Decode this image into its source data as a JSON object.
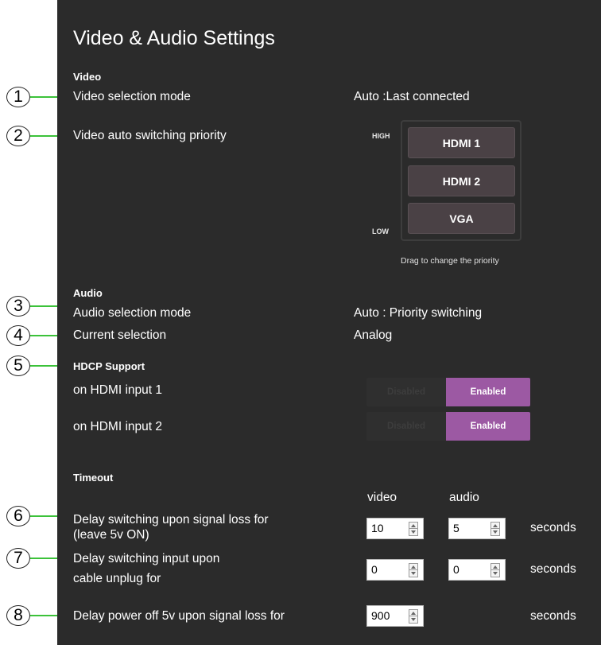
{
  "title": "Video & Audio Settings",
  "video": {
    "section_label": "Video",
    "selection_mode_label": "Video selection mode",
    "selection_mode_value": "Auto :Last connected",
    "auto_switching_priority_label": "Video auto switching priority",
    "priority_high": "HIGH",
    "priority_low": "LOW",
    "priority_items": [
      "HDMI 1",
      "HDMI 2",
      "VGA"
    ],
    "priority_hint": "Drag to change the priority"
  },
  "audio": {
    "section_label": "Audio",
    "selection_mode_label": "Audio selection mode",
    "selection_mode_value": "Auto : Priority switching",
    "current_selection_label": "Current selection",
    "current_selection_value": "Analog"
  },
  "hdcp": {
    "section_label": "HDCP Support",
    "inputs": [
      {
        "label": "on HDMI input 1",
        "off_label": "Disabled",
        "on_label": "Enabled",
        "state": "Enabled"
      },
      {
        "label": "on HDMI input 2",
        "off_label": "Disabled",
        "on_label": "Enabled",
        "state": "Enabled"
      }
    ]
  },
  "timeout": {
    "section_label": "Timeout",
    "col_video": "video",
    "col_audio": "audio",
    "units": "seconds",
    "rows": [
      {
        "label_line1": "Delay switching upon signal loss for",
        "label_line2": "(leave 5v ON)",
        "video": "10",
        "audio": "5"
      },
      {
        "label_line1": "Delay switching input upon",
        "label_line2": "cable unplug for",
        "video": "0",
        "audio": "0"
      },
      {
        "label_line1": "Delay power off 5v upon signal loss for",
        "label_line2": "",
        "video": "900"
      }
    ]
  },
  "callouts": [
    "1",
    "2",
    "3",
    "4",
    "5",
    "6",
    "7",
    "8"
  ],
  "colors": {
    "panel_bg": "#2b2b2b",
    "accent_enabled": "#9c59a3",
    "callout_arrow": "#3cc23a",
    "priority_button": "#4a4145"
  }
}
